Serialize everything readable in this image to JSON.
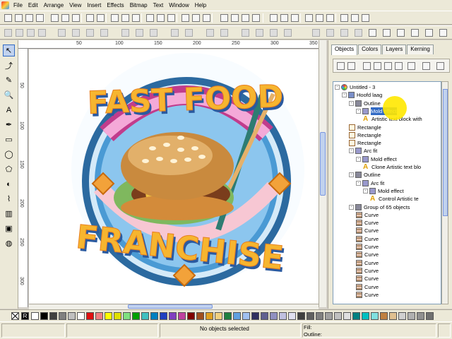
{
  "menu": [
    "File",
    "Edit",
    "Arrange",
    "View",
    "Insert",
    "Effects",
    "Bitmap",
    "Text",
    "Window",
    "Help"
  ],
  "ruler": {
    "h_ticks": [
      "50",
      "100",
      "150",
      "200",
      "250",
      "300",
      "350"
    ],
    "v_ticks": [
      "50",
      "100",
      "150",
      "200",
      "250",
      "300"
    ]
  },
  "artwork": {
    "title": "FAST FOOD",
    "subtitle": "FRANCHISE"
  },
  "docker": {
    "tabs": [
      "Objects",
      "Colors",
      "Layers",
      "Kerning"
    ],
    "tree": [
      {
        "label": "Untitled - 3",
        "icon": "page",
        "depth": 0,
        "exp": "-"
      },
      {
        "label": "Hoofd laag",
        "icon": "layer",
        "depth": 1,
        "exp": "-"
      },
      {
        "label": "Outline",
        "icon": "group",
        "depth": 2,
        "exp": "-"
      },
      {
        "label": "Mold effect",
        "icon": "effect",
        "depth": 3,
        "exp": "-",
        "selected": true
      },
      {
        "label": "Artistic text block with",
        "icon": "text",
        "depth": 4
      },
      {
        "label": "Rectangle",
        "icon": "rect",
        "depth": 2
      },
      {
        "label": "Rectangle",
        "icon": "rect",
        "depth": 2
      },
      {
        "label": "Rectangle",
        "icon": "rect",
        "depth": 2
      },
      {
        "label": "Arc fit",
        "icon": "effect",
        "depth": 2,
        "exp": "-"
      },
      {
        "label": "Mold effect",
        "icon": "effect",
        "depth": 3,
        "exp": "-"
      },
      {
        "label": "Clone Artistic text blo",
        "icon": "text",
        "depth": 4
      },
      {
        "label": "Outline",
        "icon": "group",
        "depth": 2,
        "exp": "-"
      },
      {
        "label": "Arc fit",
        "icon": "effect",
        "depth": 3,
        "exp": "-"
      },
      {
        "label": "Mold effect",
        "icon": "effect",
        "depth": 4,
        "exp": "-"
      },
      {
        "label": "Control Artistic te",
        "icon": "text",
        "depth": 5
      },
      {
        "label": "Group of 65 objects",
        "icon": "group",
        "depth": 2,
        "exp": "-"
      },
      {
        "label": "Curve",
        "icon": "curve",
        "depth": 3
      },
      {
        "label": "Curve",
        "icon": "curve",
        "depth": 3
      },
      {
        "label": "Curve",
        "icon": "curve",
        "depth": 3
      },
      {
        "label": "Curve",
        "icon": "curve",
        "depth": 3
      },
      {
        "label": "Curve",
        "icon": "curve",
        "depth": 3
      },
      {
        "label": "Curve",
        "icon": "curve",
        "depth": 3
      },
      {
        "label": "Curve",
        "icon": "curve",
        "depth": 3
      },
      {
        "label": "Curve",
        "icon": "curve",
        "depth": 3
      },
      {
        "label": "Curve",
        "icon": "curve",
        "depth": 3
      },
      {
        "label": "Curve",
        "icon": "curve",
        "depth": 3
      },
      {
        "label": "Curve",
        "icon": "curve",
        "depth": 3
      }
    ]
  },
  "palette": {
    "none_label": "R",
    "colors": [
      "#ffffff",
      "#000000",
      "#404040",
      "#808080",
      "#c0c0c0",
      "#ffffff",
      "#e01010",
      "#f08080",
      "#ffff00",
      "#e0e000",
      "#80e080",
      "#00a000",
      "#40c0c0",
      "#0080c0",
      "#2040c0",
      "#8040c0",
      "#c040a0",
      "#800000",
      "#a05020",
      "#e0a020",
      "#f0d080",
      "#208040",
      "#60a0e0",
      "#a0c0f0",
      "#303060",
      "#606090",
      "#9090c0",
      "#c0c0e0",
      "#e0e0f0",
      "#404040",
      "#606060",
      "#808080",
      "#a0a0a0",
      "#c0c0c0",
      "#e0e0e0",
      "#008080",
      "#00c0c0",
      "#80e0e0",
      "#c08040",
      "#e0c090",
      "#d0d0d0",
      "#b0b0b0",
      "#909090",
      "#707070"
    ]
  },
  "status": {
    "message": "No objects selected",
    "fill_label": "Fill:",
    "outline_label": "Outline:"
  }
}
